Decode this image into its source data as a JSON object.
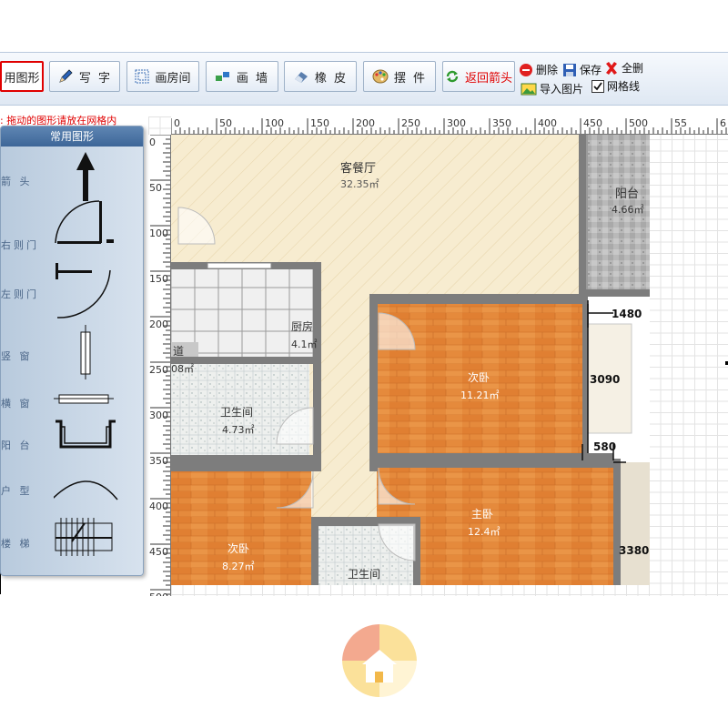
{
  "toolbar": {
    "common_shapes": "用图形",
    "write_text": "写 字",
    "draw_room": "画房间",
    "draw_wall": "画 墙",
    "eraser": "橡 皮",
    "furniture": "摆 件",
    "return_arrow": "返回箭头",
    "delete": "删除",
    "save": "保存",
    "delete_all": "全删",
    "import_image": "导入图片",
    "grid_lines": "网格线"
  },
  "hint": ": 拖动的图形请放在网格内",
  "palette": {
    "title": "常用图形",
    "items": [
      "箭 头",
      "右则门",
      "左则门",
      "竖 窗",
      "横 窗",
      "阳 台",
      "户 型",
      "楼 梯"
    ]
  },
  "ruler": {
    "top": [
      "0",
      "50",
      "100",
      "150",
      "200",
      "250",
      "300",
      "350",
      "400",
      "450",
      "500",
      "55",
      "6"
    ],
    "left": [
      "0",
      "50",
      "100",
      "150",
      "200",
      "250",
      "300",
      "350",
      "400",
      "450",
      "500"
    ]
  },
  "plan": {
    "living_room": "客餐厅",
    "living_room_area": "32.35㎡",
    "balcony": "阳台",
    "balcony_area": "4.66㎡",
    "kitchen": "厨房",
    "kitchen_area": "4.1㎡",
    "corridor": "道",
    "corridor_area": "08㎡",
    "bathroom1": "卫生间",
    "bathroom1_area": "4.73㎡",
    "bedroom2": "次卧",
    "bedroom2_area": "11.21㎡",
    "master_bedroom": "主卧",
    "master_bedroom_area": "12.4㎡",
    "bedroom3": "次卧",
    "bedroom3_area": "8.27㎡",
    "bathroom2": "卫生间",
    "dim_1480": "1480",
    "dim_3090": "3090",
    "dim_580": "580",
    "dim_3380": "3380"
  },
  "colors": {
    "floor_orange": "#e58a3c",
    "living_beige": "#f7ecd0",
    "wall_gray": "#7d7d7d",
    "accent_red": "#e00000"
  }
}
